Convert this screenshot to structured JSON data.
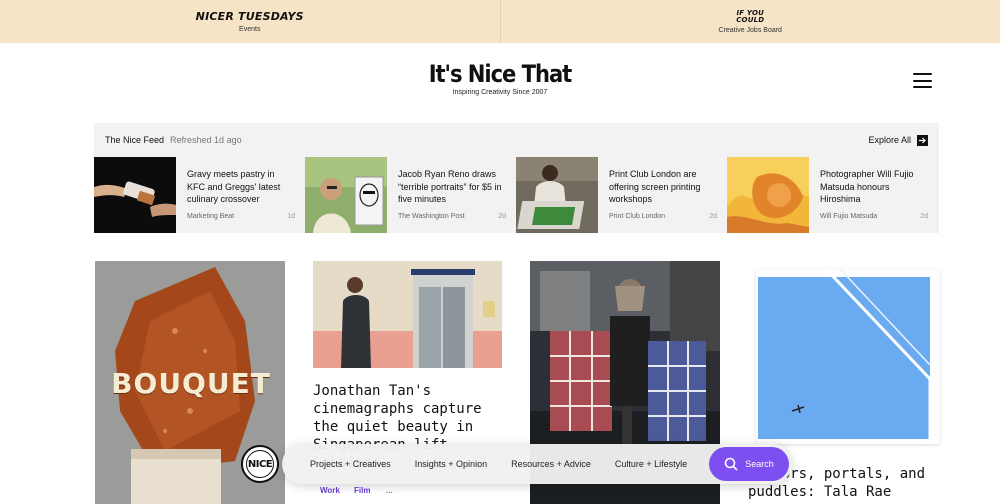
{
  "promo": {
    "left_logo": "NICER TUESDAYS",
    "left_sub": "Events",
    "right_logo": "IF YOU COULD",
    "right_sub": "Creative Jobs Board"
  },
  "brand": {
    "title": "It's Nice That",
    "tagline": "Inspiring Creativity Since 2007"
  },
  "feed": {
    "title": "The Nice Feed",
    "refreshed": "Refreshed 1d ago",
    "explore": "Explore All",
    "items": [
      {
        "headline": "Gravy meets pastry in KFC and Greggs' latest culinary crossover",
        "source": "Marketing Beat",
        "age": "1d"
      },
      {
        "headline": "Jacob Ryan Reno draws “terrible portraits” for $5 in five minutes",
        "source": "The Washington Post",
        "age": "2d"
      },
      {
        "headline": "Print Club London are offering screen printing workshops",
        "source": "Print Club London",
        "age": "2d"
      },
      {
        "headline": "Photographer Will Fujio Matsuda honours Hiroshima",
        "source": "Will Fujio Matsuda",
        "age": "2d"
      }
    ]
  },
  "cards": {
    "bouquet_word": "BOUQUET",
    "card2_title": "Jonathan Tan's cinemagraphs capture the quiet beauty in Singaporean lift lobbies",
    "card2_tags": [
      "Work",
      "Film",
      "..."
    ],
    "card4_title": "Mirrors, portals, and puddles: Tala Rae"
  },
  "nav": {
    "badge": "NICE",
    "items": [
      "Projects + Creatives",
      "Insights + Opinion",
      "Resources + Advice",
      "Culture + Lifestyle"
    ],
    "search": "Search"
  },
  "colors": {
    "promo_bg": "#f7e3c5",
    "accent": "#7e4ff0",
    "feed_bg": "#f2f2f2"
  }
}
